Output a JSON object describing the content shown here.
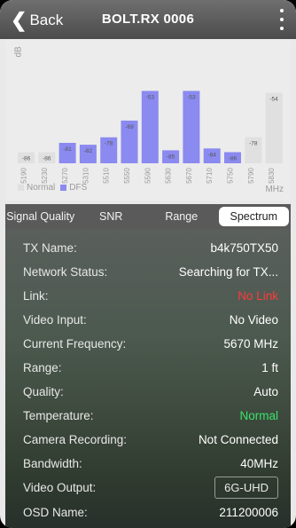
{
  "header": {
    "back_label": "Back",
    "title": "BOLT.RX 0006"
  },
  "chart_data": {
    "type": "bar",
    "ylabel": "dB",
    "xlabel": "MHz",
    "categories": [
      "5190",
      "5230",
      "5270",
      "5310",
      "5510",
      "5550",
      "5590",
      "5630",
      "5670",
      "5710",
      "5750",
      "5790",
      "5830"
    ],
    "values": [
      -86,
      -86,
      -81,
      -82,
      -78,
      -69,
      -53,
      -85,
      -53,
      -84,
      -86,
      -78,
      -54
    ],
    "band": [
      "Normal",
      "Normal",
      "DFS",
      "DFS",
      "DFS",
      "DFS",
      "DFS",
      "DFS",
      "DFS",
      "DFS",
      "DFS",
      "Normal",
      "Normal"
    ],
    "ylim": [
      -92,
      -48
    ],
    "legend": [
      {
        "name": "Normal",
        "color": "#e0e0e0"
      },
      {
        "name": "DFS",
        "color": "#8a8af0"
      }
    ],
    "colors": {
      "normal": "#e0e0e0",
      "dfs": "#8a8af0",
      "label": "#ffffff",
      "tick": "#9a9a9a"
    }
  },
  "tabs": [
    "Signal Quality",
    "SNR",
    "Range",
    "Spectrum"
  ],
  "active_tab": "Spectrum",
  "info": {
    "tx_name": {
      "label": "TX Name:",
      "value": "b4k750TX50"
    },
    "network_status": {
      "label": "Network Status:",
      "value": "Searching for TX..."
    },
    "link": {
      "label": "Link:",
      "value": "No Link"
    },
    "video_input": {
      "label": "Video Input:",
      "value": "No Video"
    },
    "current_frequency": {
      "label": "Current Frequency:",
      "value": "5670 MHz"
    },
    "range": {
      "label": "Range:",
      "value": "1 ft"
    },
    "quality": {
      "label": "Quality:",
      "value": "Auto"
    },
    "temperature": {
      "label": "Temperature:",
      "value": "Normal"
    },
    "camera_recording": {
      "label": "Camera Recording:",
      "value": "Not Connected"
    },
    "bandwidth": {
      "label": "Bandwidth:",
      "value": "40MHz"
    },
    "video_output": {
      "label": "Video Output:",
      "value": "6G-UHD"
    },
    "osd_name": {
      "label": "OSD Name:",
      "value": "211200006"
    }
  },
  "status_colors": {
    "error": "#ff3a3a",
    "ok": "#39e36a"
  }
}
